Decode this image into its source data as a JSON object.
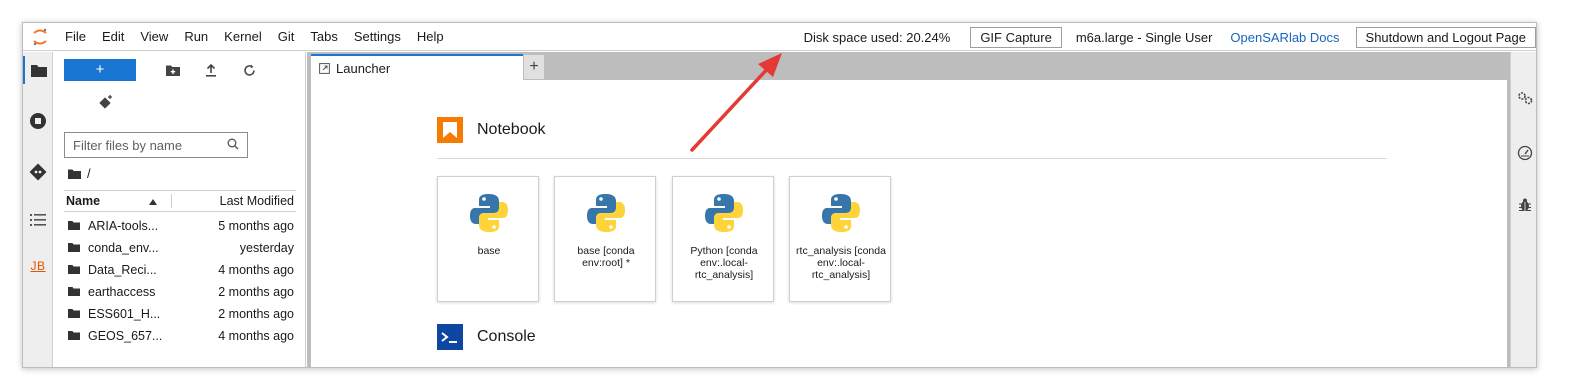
{
  "menu": {
    "items": [
      "File",
      "Edit",
      "View",
      "Run",
      "Kernel",
      "Git",
      "Tabs",
      "Settings",
      "Help"
    ],
    "disk_space": "Disk space used: 20.24%",
    "gif_capture": "GIF Capture",
    "instance": "m6a.large - Single User",
    "docs_link": "OpenSARlab Docs",
    "shutdown": "Shutdown and Logout Page"
  },
  "colors": {
    "accent": "#1976d2",
    "arrow": "#e53935",
    "launcher_icon": "#f57c00",
    "docs_link": "#1565c0"
  },
  "leftbar": {
    "jb_label": "JB"
  },
  "filebrowser": {
    "new_label": "+",
    "filter_placeholder": "Filter files by name",
    "breadcrumb": "/",
    "header_name": "Name",
    "header_modified": "Last Modified",
    "rows": [
      {
        "name": "ARIA-tools...",
        "modified": "5 months ago"
      },
      {
        "name": "conda_env...",
        "modified": "yesterday"
      },
      {
        "name": "Data_Reci...",
        "modified": "4 months ago"
      },
      {
        "name": "earthaccess",
        "modified": "2 months ago"
      },
      {
        "name": "ESS601_H...",
        "modified": "2 months ago"
      },
      {
        "name": "GEOS_657...",
        "modified": "4 months ago"
      }
    ]
  },
  "tabs": [
    {
      "label": "Launcher"
    }
  ],
  "launcher": {
    "notebook_section": "Notebook",
    "console_section": "Console",
    "kernels": [
      {
        "label": "base"
      },
      {
        "label": "base [conda env:root] *"
      },
      {
        "label": "Python [conda env:.local-rtc_analysis]"
      },
      {
        "label": "rtc_analysis [conda env:.local-rtc_analysis]"
      }
    ]
  }
}
